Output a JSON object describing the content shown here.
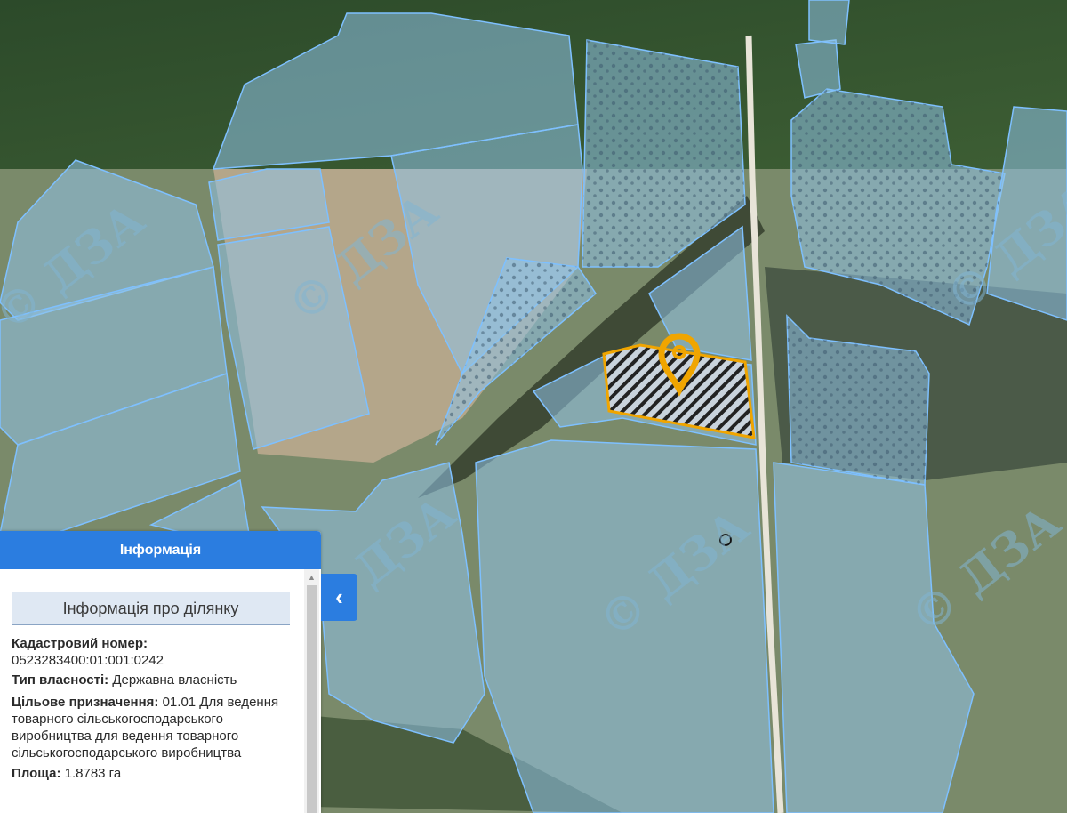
{
  "map": {
    "watermark_text": "© ДЗА",
    "parcel_fill_color": "#8fc3e8",
    "parcel_border_color": "#7ec0ff",
    "selected_border_color": "#f0a500",
    "marker_color": "#f0a500"
  },
  "panel": {
    "header_title": "Інформація",
    "section_title": "Інформація про ділянку",
    "cadastral_label": "Кадастровий номер:",
    "cadastral_value": "0523283400:01:001:0242",
    "ownership_label": "Тип власності:",
    "ownership_value": "Державна власність",
    "purpose_label": "Цільове призначення:",
    "purpose_value": "01.01 Для ведення товарного сільськогосподарського виробництва для ведення товарного сільськогосподарського виробництва",
    "area_label": "Площа:",
    "area_value": "1.8783 га",
    "collapse_icon": "chevron-left-icon",
    "scroll_up_icon": "triangle-up-icon"
  }
}
